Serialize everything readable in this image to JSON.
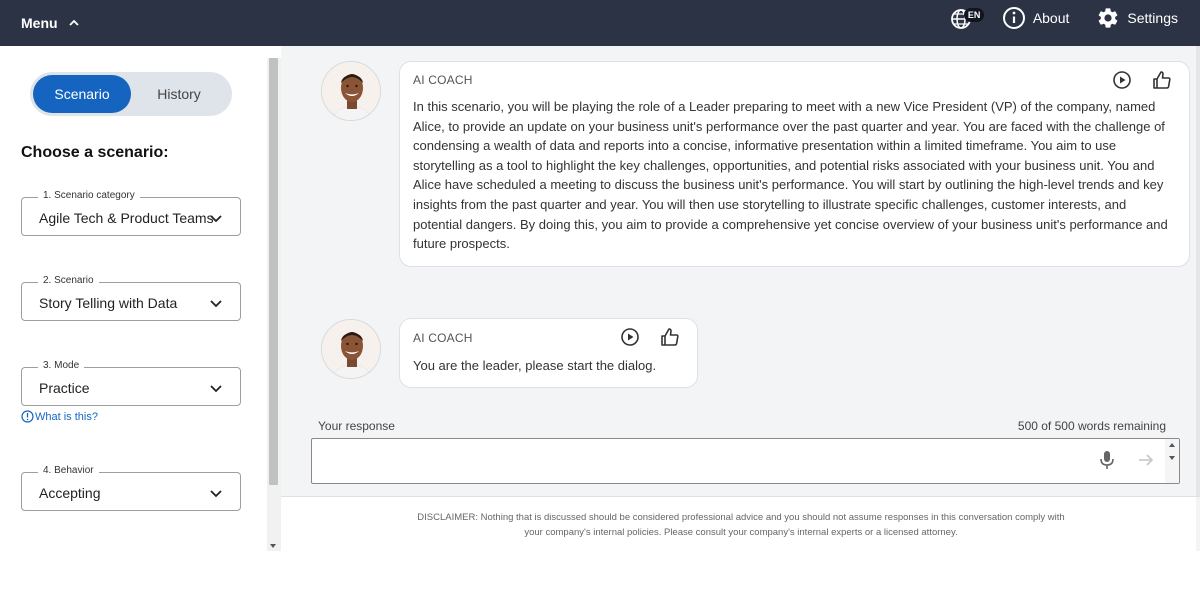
{
  "header": {
    "menu_label": "Menu",
    "language_badge": "EN",
    "about_label": "About",
    "settings_label": "Settings"
  },
  "sidebar": {
    "tabs": {
      "scenario": "Scenario",
      "history": "History",
      "active": "Scenario"
    },
    "choose_title": "Choose a scenario:",
    "fields": [
      {
        "label": "1. Scenario category",
        "value": "Agile Tech & Product Teams"
      },
      {
        "label": "2. Scenario",
        "value": "Story Telling with Data"
      },
      {
        "label": "3. Mode",
        "value": "Practice"
      },
      {
        "label": "4. Behavior",
        "value": "Accepting"
      }
    ],
    "what_is_this": "What is this?"
  },
  "chat": {
    "messages": [
      {
        "sender": "AI COACH",
        "text": "In this scenario, you will be playing the role of a Leader preparing to meet with a new Vice President (VP) of the company, named Alice, to provide an update on your business unit's performance over the past quarter and year. You are faced with the challenge of condensing a wealth of data and reports into a concise, informative presentation within a limited timeframe. You aim to use storytelling as a tool to highlight the key challenges, opportunities, and potential risks associated with your business unit. You and Alice have scheduled a meeting to discuss the business unit's performance. You will start by outlining the high-level trends and key insights from the past quarter and year. You will then use storytelling to illustrate specific challenges, customer interests, and potential dangers. By doing this, you aim to provide a comprehensive yet concise overview of your business unit's performance and future prospects."
      },
      {
        "sender": "AI COACH",
        "text": "You are the leader, please start the dialog."
      }
    ]
  },
  "response": {
    "label": "Your response",
    "counter": "500 of 500 words remaining",
    "value": ""
  },
  "disclaimer": "DISCLAIMER: Nothing that is discussed should be considered professional advice and you should not assume responses in this conversation comply with your company's internal policies. Please consult your company's internal experts or a licensed attorney.",
  "colors": {
    "topbar": "#2b3345",
    "accent": "#1565c0",
    "main_bg": "#f3f4f6"
  }
}
